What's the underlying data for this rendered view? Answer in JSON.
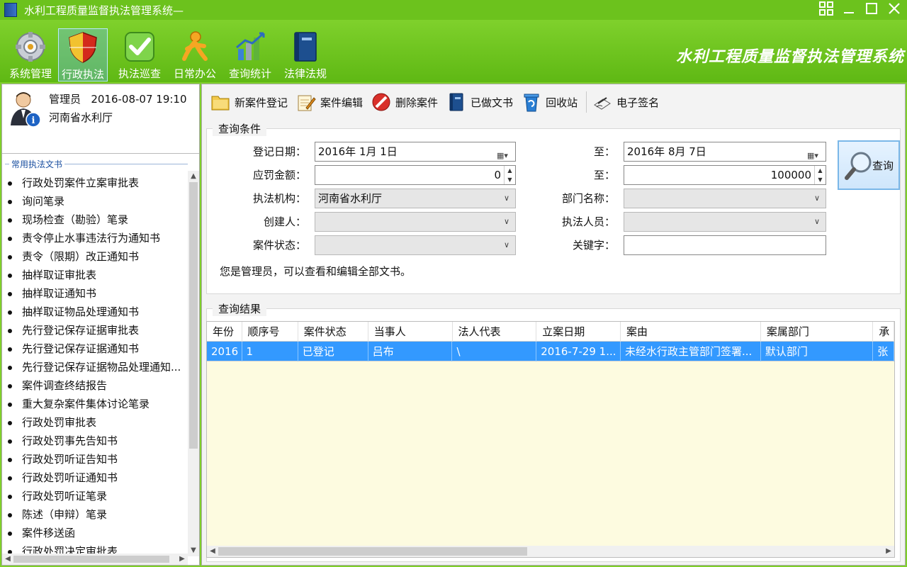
{
  "window": {
    "title": "水利工程质量监督执法管理系统—"
  },
  "menubar": {
    "items": [
      {
        "label": "系统管理",
        "icon": "gear-icon"
      },
      {
        "label": "行政执法",
        "icon": "shield-icon",
        "active": true
      },
      {
        "label": "执法巡查",
        "icon": "check-icon"
      },
      {
        "label": "日常办公",
        "icon": "person-icon"
      },
      {
        "label": "查询统计",
        "icon": "chart-icon"
      },
      {
        "label": "法律法规",
        "icon": "book-icon"
      }
    ],
    "brand": "水利工程质量监督执法管理系统"
  },
  "user": {
    "role": "管理员",
    "datetime": "2016-08-07 19:10",
    "org": "河南省水利厅"
  },
  "docs": {
    "group_title": "常用执法文书",
    "items": [
      "行政处罚案件立案审批表",
      "询问笔录",
      "现场检查（勘验）笔录",
      "责令停止水事违法行为通知书",
      "责令（限期）改正通知书",
      "抽样取证审批表",
      "抽样取证通知书",
      "抽样取证物品处理通知书",
      "先行登记保存证据审批表",
      "先行登记保存证据通知书",
      "先行登记保存证据物品处理通知...",
      "案件调查终结报告",
      "重大复杂案件集体讨论笔录",
      "行政处罚审批表",
      "行政处罚事先告知书",
      "行政处罚听证告知书",
      "行政处罚听证通知书",
      "行政处罚听证笔录",
      "陈述（申辩）笔录",
      "案件移送函",
      "行政处罚决定审批表"
    ]
  },
  "toolbar": {
    "new_case": "新案件登记",
    "edit_case": "案件编辑",
    "delete_case": "删除案件",
    "done_docs": "已做文书",
    "recycle": "回收站",
    "e_sign": "电子签名"
  },
  "query": {
    "legend": "查询条件",
    "reg_date_label": "登记日期：",
    "reg_date_from": "2016年  1月  1日",
    "to_label": "至：",
    "reg_date_to": "2016年  8月  7日",
    "fine_label": "应罚金额：",
    "fine_from": "0",
    "fine_to": "100000",
    "agency_label": "执法机构：",
    "agency_value": "河南省水利厅",
    "dept_label": "部门名称：",
    "dept_value": "",
    "creator_label": "创建人：",
    "creator_value": "",
    "officer_label": "执法人员：",
    "officer_value": "",
    "status_label": "案件状态：",
    "status_value": "",
    "keyword_label": "关键字：",
    "keyword_value": "",
    "search_button": "查询",
    "note": "您是管理员，可以查看和编辑全部文书。"
  },
  "results": {
    "legend": "查询结果",
    "columns": [
      "年份",
      "顺序号",
      "案件状态",
      "当事人",
      "法人代表",
      "立案日期",
      "案由",
      "案属部门",
      "承"
    ],
    "rows": [
      [
        "2016",
        "1",
        "已登记",
        "吕布",
        "\\",
        "2016-7-29 1...",
        "未经水行政主管部门签署...",
        "默认部门",
        "张"
      ]
    ]
  }
}
